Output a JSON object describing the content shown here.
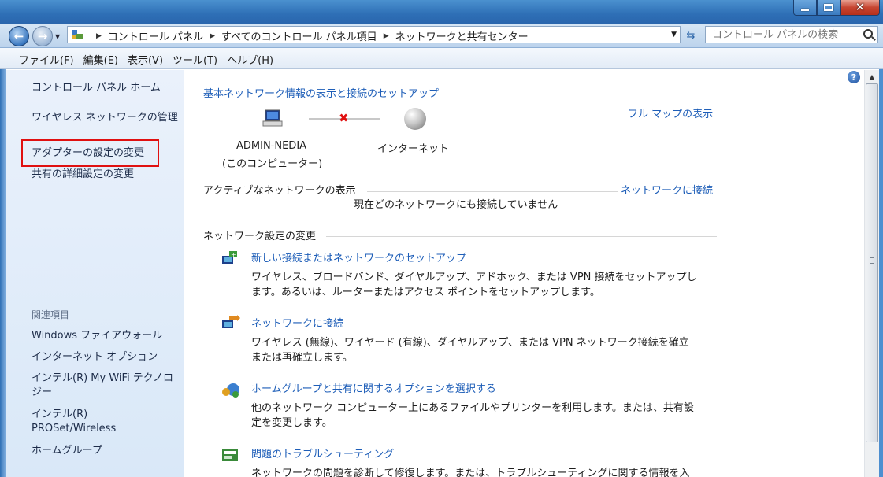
{
  "breadcrumbs": [
    "コントロール パネル",
    "すべてのコントロール パネル項目",
    "ネットワークと共有センター"
  ],
  "search": {
    "placeholder": "コントロール パネルの検索"
  },
  "menu": [
    "ファイル(F)",
    "編集(E)",
    "表示(V)",
    "ツール(T)",
    "ヘルプ(H)"
  ],
  "sidebar": {
    "items": [
      "コントロール パネル ホーム",
      "ワイヤレス ネットワークの管理",
      "アダプターの設定の変更",
      "共有の詳細設定の変更"
    ],
    "related_heading": "関連項目",
    "related": [
      "Windows ファイアウォール",
      "インターネット オプション",
      "インテル(R) My WiFi テクノロジー",
      "インテル(R) PROSet/Wireless",
      "ホームグループ"
    ]
  },
  "main": {
    "header_link": "基本ネットワーク情報の表示と接続のセットアップ",
    "full_map_link": "フル マップの表示",
    "computer_name": "ADMIN-NEDIA",
    "computer_sub": "(このコンピューター)",
    "internet_label": "インターネット",
    "active_heading": "アクティブなネットワークの表示",
    "connect_link": "ネットワークに接続",
    "no_connection": "現在どのネットワークにも接続していません",
    "settings_heading": "ネットワーク設定の変更",
    "tasks": [
      {
        "title": "新しい接続またはネットワークのセットアップ",
        "desc1": "ワイヤレス、ブロードバンド、ダイヤルアップ、アドホック、または VPN 接続をセットアップし",
        "desc2": "ます。あるいは、ルーターまたはアクセス ポイントをセットアップします。"
      },
      {
        "title": "ネットワークに接続",
        "desc1": "ワイヤレス (無線)、ワイヤード (有線)、ダイヤルアップ、または VPN ネットワーク接続を確立",
        "desc2": "または再確立します。"
      },
      {
        "title": "ホームグループと共有に関するオプションを選択する",
        "desc1": "他のネットワーク コンピューター上にあるファイルやプリンターを利用します。または、共有設",
        "desc2": "定を変更します。"
      },
      {
        "title": "問題のトラブルシューティング",
        "desc1": "ネットワークの問題を診断して修復します。または、トラブルシューティングに関する情報を入",
        "desc2": ""
      }
    ]
  },
  "colors": {
    "link": "#1e5eb8",
    "highlight": "#e01010",
    "sidebar": "#e3edf9"
  }
}
